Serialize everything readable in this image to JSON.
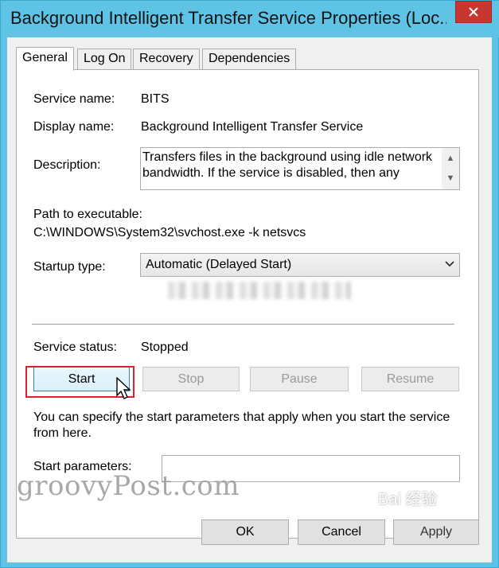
{
  "window": {
    "title": "Background Intelligent Transfer Service Properties (Loc..."
  },
  "tabs": [
    {
      "label": "General",
      "active": true
    },
    {
      "label": "Log On",
      "active": false
    },
    {
      "label": "Recovery",
      "active": false
    },
    {
      "label": "Dependencies",
      "active": false
    }
  ],
  "general": {
    "service_name_label": "Service name:",
    "service_name_value": "BITS",
    "display_name_label": "Display name:",
    "display_name_value": "Background Intelligent Transfer Service",
    "description_label": "Description:",
    "description_value": "Transfers files in the background using idle network bandwidth. If the service is disabled, then any",
    "path_label": "Path to executable:",
    "path_value": "C:\\WINDOWS\\System32\\svchost.exe -k netsvcs",
    "startup_type_label": "Startup type:",
    "startup_type_value": "Automatic (Delayed Start)",
    "service_status_label": "Service status:",
    "service_status_value": "Stopped",
    "start_label": "Start",
    "stop_label": "Stop",
    "pause_label": "Pause",
    "resume_label": "Resume",
    "hint_text": "You can specify the start parameters that apply when you start the service from here.",
    "start_params_label": "Start parameters:",
    "start_params_value": ""
  },
  "footer": {
    "ok_label": "OK",
    "cancel_label": "Cancel",
    "apply_label": "Apply"
  },
  "watermarks": {
    "groovy": "groovyPost.com",
    "baidu": "Bai 经验"
  },
  "colors": {
    "title_bar": "#5fc3e6",
    "close_button": "#c7372f",
    "highlight_box": "#e02030"
  }
}
